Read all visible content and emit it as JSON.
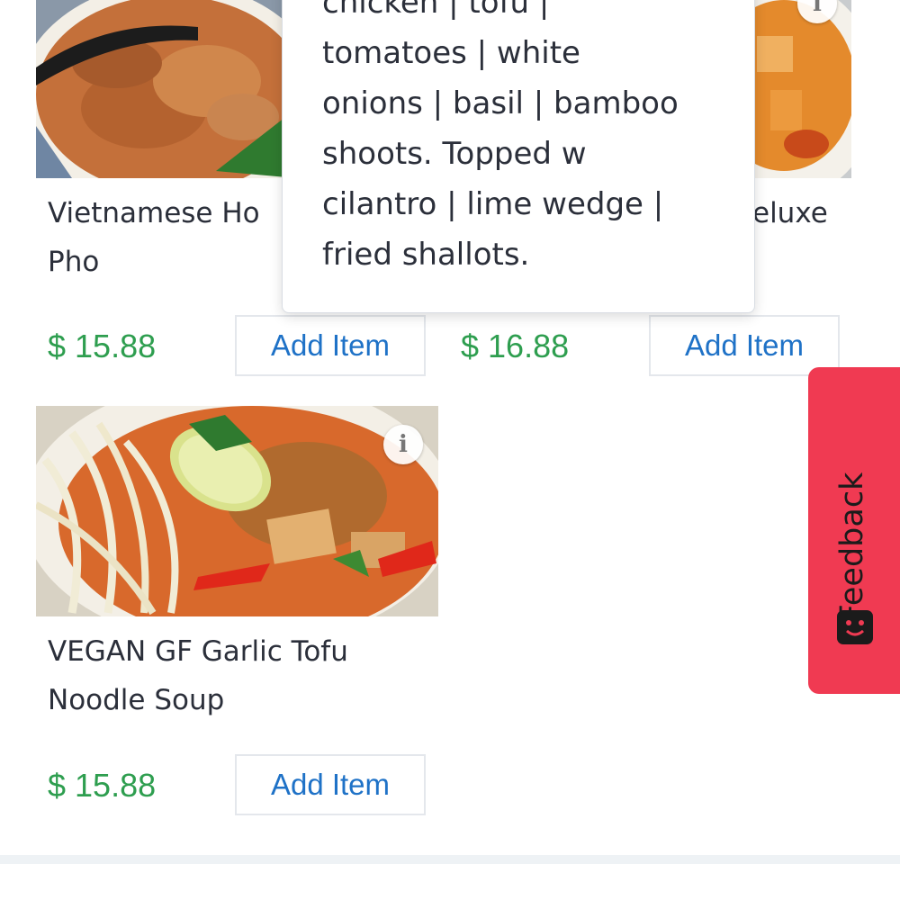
{
  "items": [
    {
      "name_line1": "Vietnamese Ho",
      "name_line2": "Pho",
      "price": "$ 15.88",
      "button": "Add Item"
    },
    {
      "name_fragment": "eluxe",
      "price": "$ 16.88",
      "button": "Add Item"
    },
    {
      "name_line1": "VEGAN GF Garlic Tofu",
      "name_line2": "Noodle Soup",
      "price": "$ 15.88",
      "button": "Add Item",
      "info_icon": "i"
    }
  ],
  "tooltip": {
    "lines": [
      "chicken | tofu |",
      "tomatoes | white",
      "onions | basil | bamboo",
      "shoots. Topped w",
      "cilantro | lime wedge |",
      "fried shallots."
    ]
  },
  "corner_info_icon": "i",
  "feedback": {
    "label": "Feedback",
    "icon": "smile-face-icon"
  },
  "colors": {
    "price": "#2e9e4f",
    "button_text": "#1f72c7",
    "feedback_bg": "#f03a52"
  }
}
